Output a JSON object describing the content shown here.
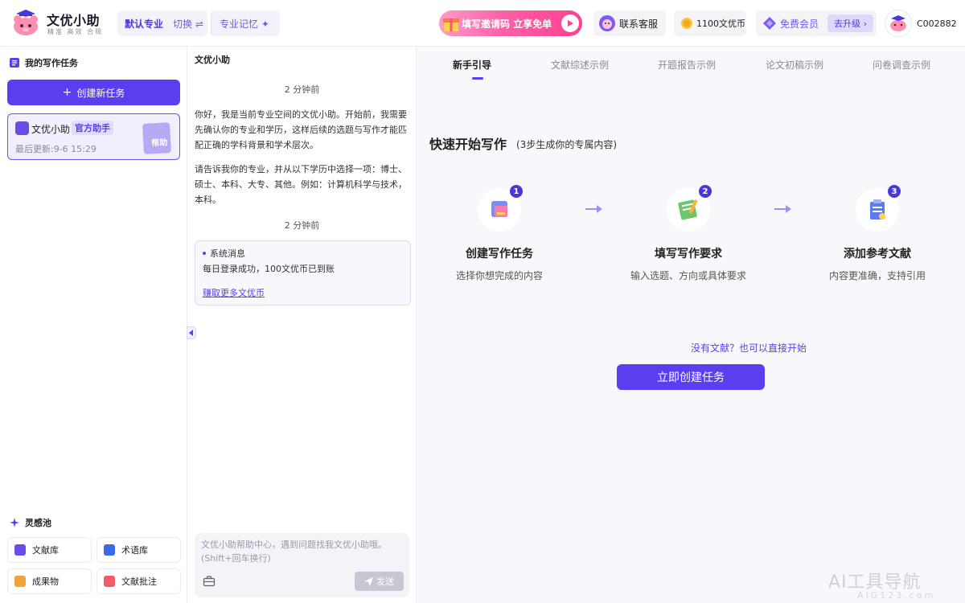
{
  "header": {
    "brand_name": "文优小助",
    "brand_slogan": "精准 高效 合规",
    "default_major": "默认专业",
    "switch_label": "切换 ⇌",
    "major_memory": "专业记忆 ✦",
    "promo_text": "填写邀请码 立享免单",
    "service_label": "联系客服",
    "coins_label": "1100文优币",
    "vip_label": "免费会员",
    "upgrade_label": "去升级 ›",
    "username": "C002882"
  },
  "sidebar": {
    "tasks_title": "我的写作任务",
    "create_task": "创建新任务",
    "task_card": {
      "name": "文优小助",
      "badge": "官方助手",
      "updated": "最后更新:9-6 15:29",
      "doc_label": "帮助"
    },
    "inspiration_title": "灵感池",
    "tools": [
      {
        "label": "文献库",
        "color": "#6a4de8"
      },
      {
        "label": "术语库",
        "color": "#3c6be8"
      },
      {
        "label": "成果物",
        "color": "#f2a23a"
      },
      {
        "label": "文献批注",
        "color": "#ef5c6b"
      }
    ]
  },
  "chat": {
    "title": "文优小助",
    "time1": "2 分钟前",
    "msg1": "你好，我是当前专业空间的文优小助。开始前，我需要先确认你的专业和学历，这样后续的选题与写作才能匹配正确的学科背景和学术层次。",
    "msg2": "请告诉我你的专业，并从以下学历中选择一项：博士、硕士、本科、大专、其他。例如：计算机科学与技术，本科。",
    "time2": "2 分钟前",
    "sys_title": "系统消息",
    "sys_body": "每日登录成功，100文优币已到账",
    "sys_link": "赚取更多文优币",
    "input_placeholder": "文优小助帮助中心，遇到问题找我文优小助哦。\n(Shift+回车换行)",
    "send_label": "发送"
  },
  "main": {
    "tabs": [
      "新手引导",
      "文献综述示例",
      "开题报告示例",
      "论文初稿示例",
      "问卷调查示例"
    ],
    "active_tab": "新手引导",
    "quick_title": "快速开始写作",
    "quick_sub": "(3步生成你的专属内容)",
    "steps": [
      {
        "num": "1",
        "title": "创建写作任务",
        "desc": "选择你想完成的内容"
      },
      {
        "num": "2",
        "title": "填写写作要求",
        "desc": "输入选题、方向或具体要求"
      },
      {
        "num": "3",
        "title": "添加参考文献",
        "desc": "内容更准确，支持引用"
      }
    ],
    "no_literature": "没有文献？也可以直接开始",
    "start_button": "立即创建任务"
  },
  "watermark": {
    "main": "AI工具导航",
    "sub": "AIG123.com"
  },
  "colors": {
    "accent": "#5b3ef0",
    "promo": "#ff5fa8"
  }
}
